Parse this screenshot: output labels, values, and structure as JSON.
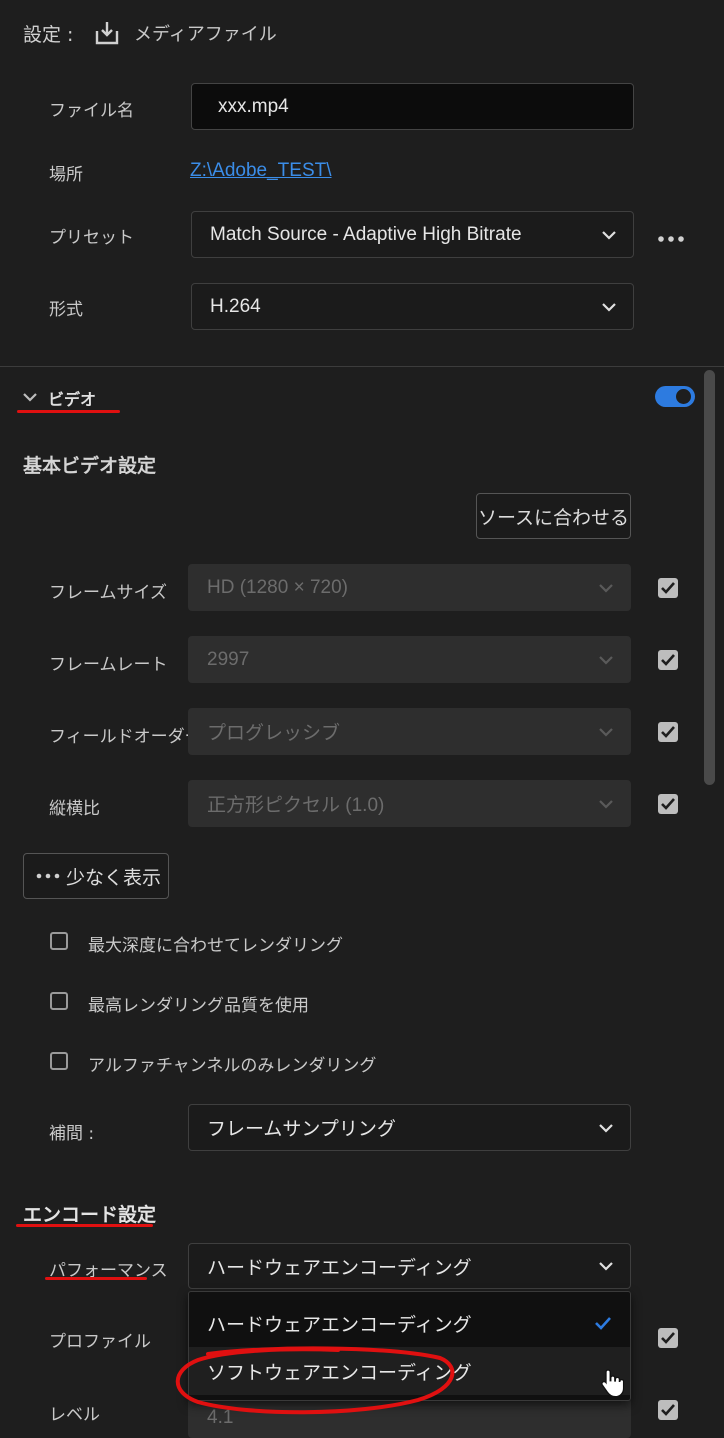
{
  "header": {
    "settings_label": "設定 :",
    "media_file_label": "メディアファイル"
  },
  "output": {
    "filename_label": "ファイル名",
    "filename_value": "xxx.mp4",
    "location_label": "場所",
    "location_value": "Z:\\Adobe_TEST\\",
    "preset_label": "プリセット",
    "preset_value": "Match Source - Adaptive High Bitrate",
    "format_label": "形式",
    "format_value": "H.264"
  },
  "video": {
    "section_label": "ビデオ",
    "enabled": true,
    "basic_title": "基本ビデオ設定",
    "match_source_button": "ソースに合わせる",
    "rows": [
      {
        "label": "フレームサイズ",
        "value": "HD (1280 × 720)",
        "checked": true
      },
      {
        "label": "フレームレート",
        "value": "2997",
        "checked": true
      },
      {
        "label": "フィールドオーダー",
        "value": "プログレッシブ",
        "checked": true
      },
      {
        "label": "縦横比",
        "value": "正方形ピクセル (1.0)",
        "checked": true
      }
    ],
    "show_less_button": "少なく表示",
    "options": [
      {
        "label": "最大深度に合わせてレンダリング",
        "checked": false
      },
      {
        "label": "最高レンダリング品質を使用",
        "checked": false
      },
      {
        "label": "アルファチャンネルのみレンダリング",
        "checked": false
      }
    ],
    "interpolation_label": "補間 :",
    "interpolation_value": "フレームサンプリング"
  },
  "encode": {
    "title": "エンコード設定",
    "performance_label": "パフォーマンス",
    "performance_value": "ハードウェアエンコーディング",
    "profile_label": "プロファイル",
    "level_label": "レベル",
    "level_value": "4.1",
    "dropdown_options": [
      "ハードウェアエンコーディング",
      "ソフトウェアエンコーディング"
    ],
    "selected_option": "ハードウェアエンコーディング"
  },
  "colors": {
    "accent": "#2d7be0",
    "annotation": "#e01010",
    "link": "#3b8de8"
  }
}
